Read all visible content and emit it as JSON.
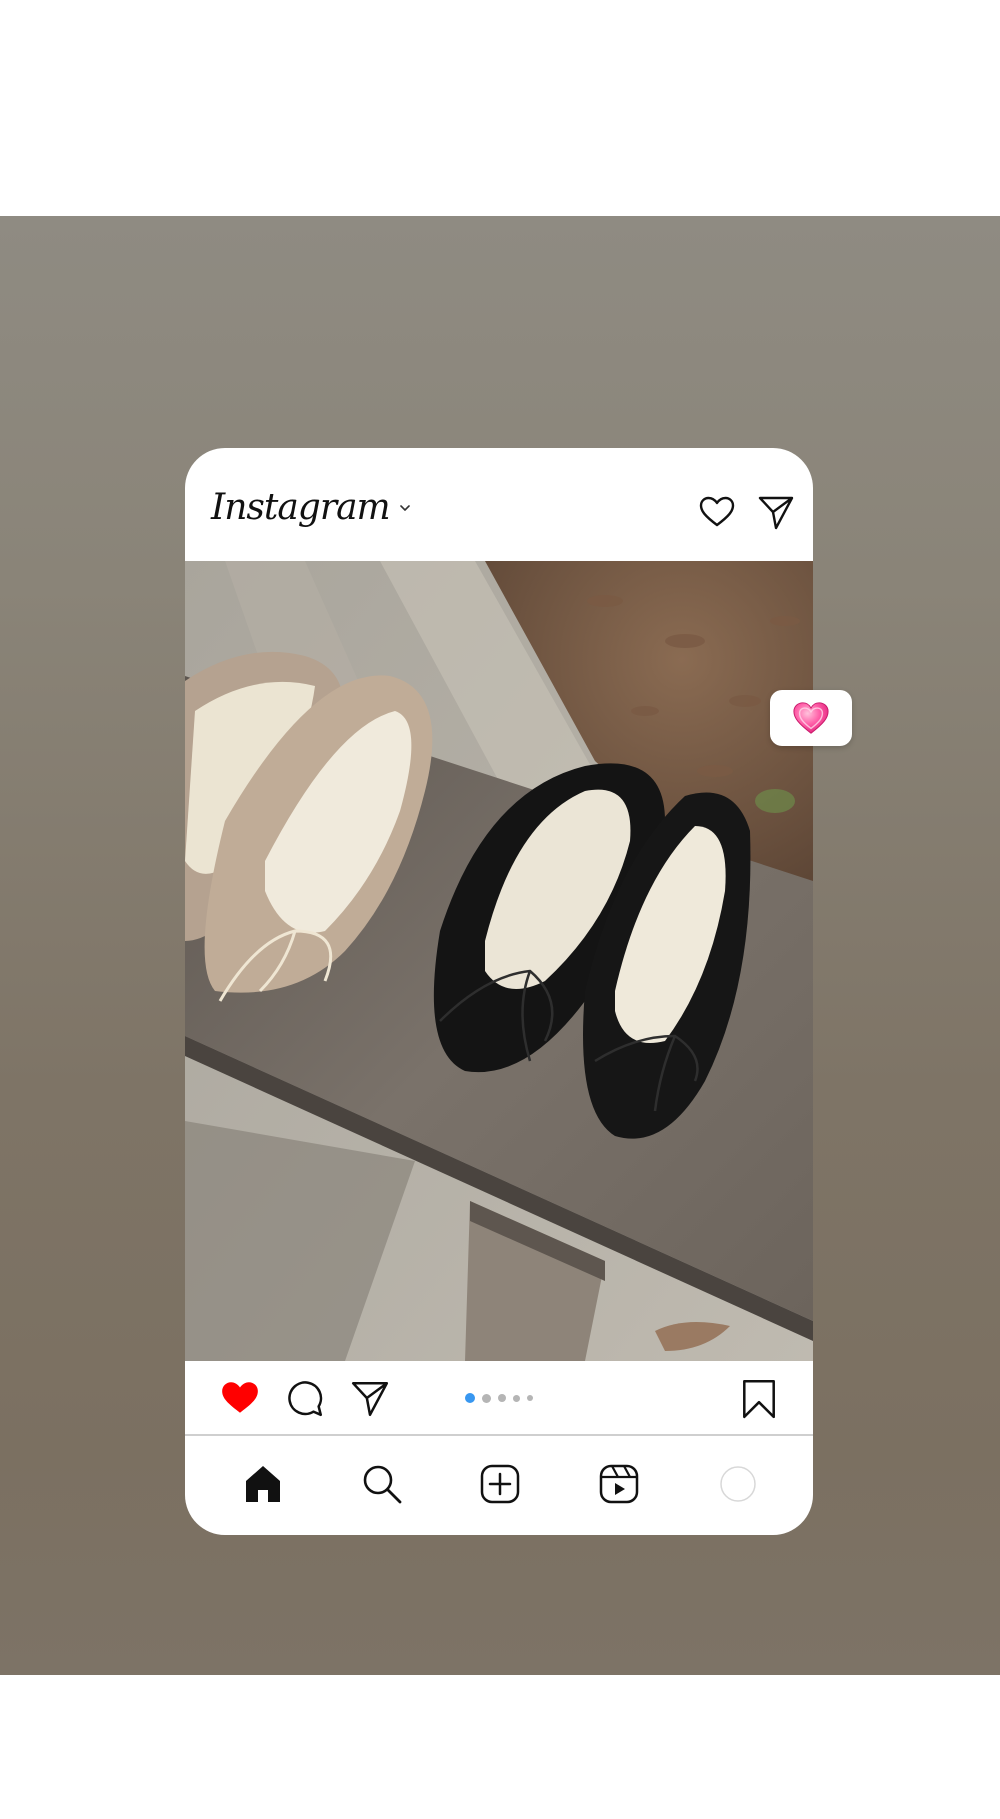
{
  "header": {
    "logo_text": "Instagram",
    "icons": [
      "chevron-down-icon",
      "heart-icon",
      "direct-message-icon"
    ]
  },
  "post": {
    "liked": true,
    "like_color": "#ff0000",
    "carousel": {
      "total": 5,
      "current": 1,
      "active_color": "#3897f0"
    },
    "action_icons": [
      "heart-icon",
      "comment-icon",
      "share-icon",
      "bookmark-icon"
    ]
  },
  "reaction": {
    "emoji_icon": "pink-heart-emoji-icon"
  },
  "tabbar": {
    "items": [
      "home-icon",
      "search-icon",
      "new-post-icon",
      "reels-icon",
      "profile-icon"
    ],
    "active": "home"
  }
}
